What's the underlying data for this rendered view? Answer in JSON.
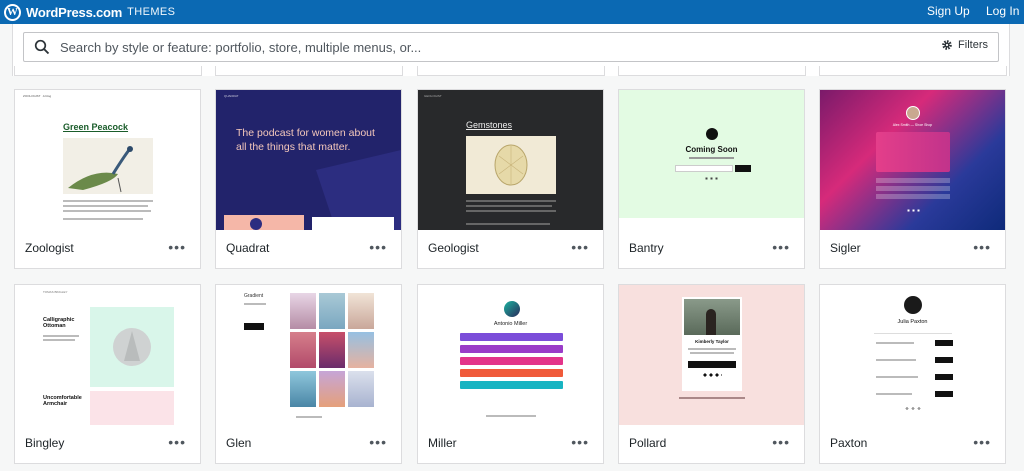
{
  "header": {
    "brand": "WordPress.com",
    "section": "THEMES",
    "signup": "Sign Up",
    "login": "Log In"
  },
  "search": {
    "placeholder": "Search by style or feature: portfolio, store, multiple menus, or...",
    "filters_label": "Filters"
  },
  "themes": [
    {
      "name": "Zoologist",
      "preview_title": "Green Peacock"
    },
    {
      "name": "Quadrat",
      "preview_title": "The podcast for women about all the things that matter."
    },
    {
      "name": "Geologist",
      "preview_title": "Gemstones"
    },
    {
      "name": "Bantry",
      "preview_title": "Coming Soon"
    },
    {
      "name": "Sigler",
      "preview_title": "Alex Smith — Shoe Shop"
    },
    {
      "name": "Bingley",
      "preview_title_1": "Calligraphic Ottoman",
      "preview_title_2": "Uncomfortable Armchair",
      "preview_header": "TOMAS BINGLEY"
    },
    {
      "name": "Glen",
      "preview_title": "Gradient"
    },
    {
      "name": "Miller",
      "preview_title": "Antonio Miller"
    },
    {
      "name": "Pollard",
      "preview_title": "Kimberly Taylor"
    },
    {
      "name": "Paxton",
      "preview_title": "Julia Paxton"
    }
  ],
  "more_glyph": "•••",
  "colors": {
    "topbar": "#0b69b3",
    "page_bg": "#f6f7f7"
  }
}
